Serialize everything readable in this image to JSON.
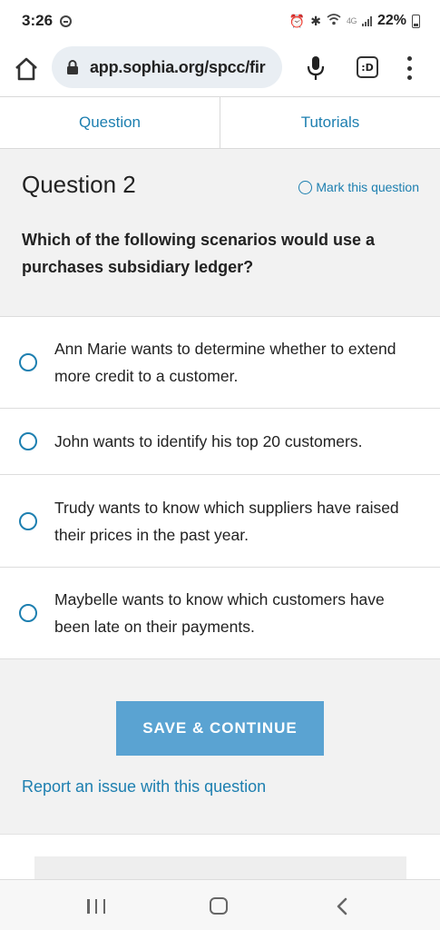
{
  "status_bar": {
    "time": "3:26",
    "network_label": "4G",
    "battery_percent": "22%",
    "icons": [
      "do-not-disturb-icon",
      "alarm-icon",
      "bluetooth-icon",
      "wifi-icon",
      "signal-icon",
      "battery-icon"
    ]
  },
  "browser": {
    "url": "app.sophia.org/spcc/fir",
    "tab_button_label": ":D",
    "icons": [
      "home-icon",
      "lock-icon",
      "mic-icon",
      "tab-switcher-icon",
      "more-menu-icon"
    ]
  },
  "tabs": [
    {
      "label": "Question"
    },
    {
      "label": "Tutorials"
    }
  ],
  "question": {
    "title": "Question 2",
    "mark_label": "Mark this question",
    "prompt": "Which of the following scenarios would use a purchases subsidiary ledger?"
  },
  "options": [
    {
      "text": "Ann Marie wants to determine whether to extend more credit to a customer."
    },
    {
      "text": "John wants to identify his top 20 customers."
    },
    {
      "text": "Trudy wants to know which suppliers have raised their prices in the past year."
    },
    {
      "text": "Maybelle wants to know which customers have been late on their payments."
    }
  ],
  "actions": {
    "save_label": "SAVE & CONTINUE",
    "report_label": "Report an issue with this question"
  },
  "colors": {
    "accent": "#1d7fb0",
    "button": "#5aa3d2",
    "background": "#f2f2f2"
  }
}
